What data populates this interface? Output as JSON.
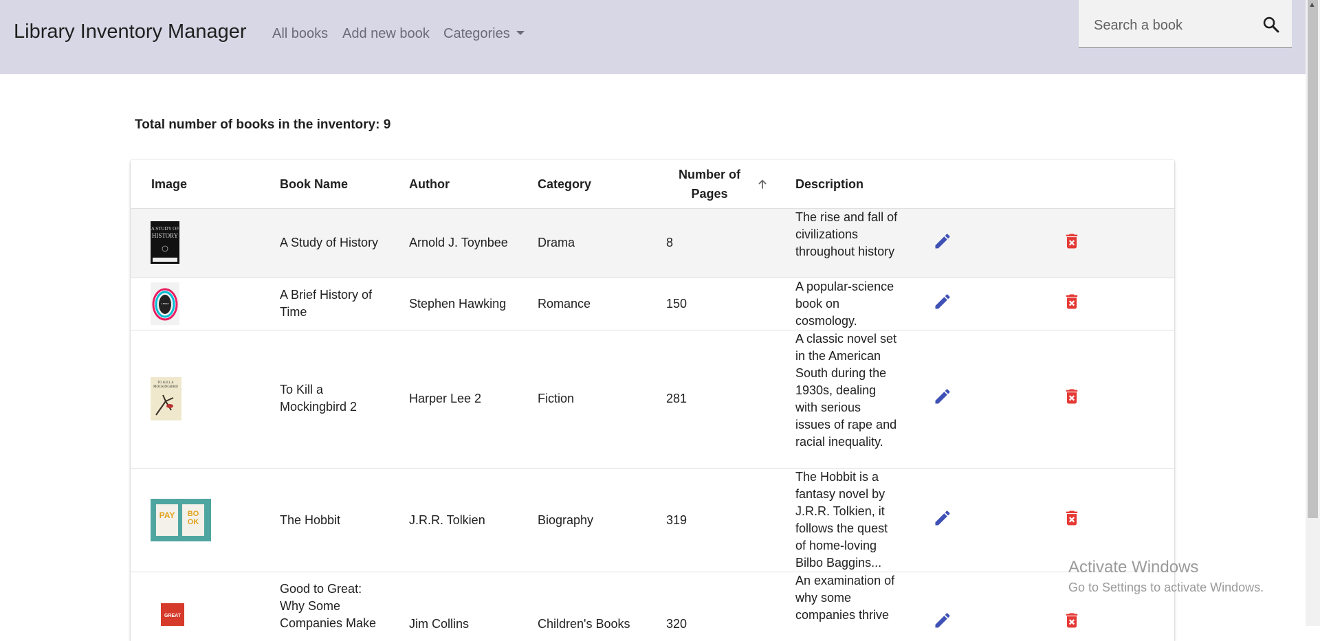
{
  "app": {
    "title": "Library Inventory Manager",
    "nav": {
      "all_books": "All books",
      "add_new_book": "Add new book",
      "categories": "Categories"
    },
    "search": {
      "placeholder": "Search a book",
      "value": "",
      "icon": "search-icon"
    }
  },
  "summary": {
    "total_label": "Total number of books in the inventory: 9"
  },
  "table": {
    "headers": {
      "image": "Image",
      "book_name": "Book Name",
      "author": "Author",
      "category": "Category",
      "pages": "Number of Pages",
      "description": "Description"
    },
    "sort": {
      "column": "pages",
      "direction": "ascending",
      "icon": "arrow-up-icon"
    },
    "rows": [
      {
        "name": "A Study of History",
        "author": "Arnold J. Toynbee",
        "category": "Drama",
        "pages": "8",
        "description": "The rise and fall of civilizations throughout history",
        "cover_text": "A STUDY OF HISTORY",
        "cover_subtext": "ARNOLD J. TOYNBEE"
      },
      {
        "name": "A Brief History of Time",
        "author": "Stephen Hawking",
        "category": "Romance",
        "pages": "150",
        "description": "A popular-science book on cosmology.",
        "cover_text": "A BRIEF HISTORY OF TIME"
      },
      {
        "name": "To Kill a Mockingbird 2",
        "author": "Harper Lee 2",
        "category": "Fiction",
        "pages": "281",
        "description": "A classic novel set in the American South during the 1930s, dealing with serious issues of rape and racial inequality.",
        "cover_text": "TO KILL A MOCKINGBIRD"
      },
      {
        "name": "The Hobbit",
        "author": "J.R.R. Tolkien",
        "category": "Biography",
        "pages": "319",
        "description": "The Hobbit is a fantasy novel by J.R.R. Tolkien, it follows the quest of home-loving Bilbo Baggins...",
        "cover_text": "BOOK"
      },
      {
        "name": "Good to Great: Why Some Companies Make",
        "author": "Jim Collins",
        "category": "Children's Books",
        "pages": "320",
        "description": "An examination of why some companies thrive",
        "cover_text": "GREAT"
      }
    ],
    "row_icons": {
      "edit": "pencil-icon",
      "delete": "trash-icon"
    }
  },
  "colors": {
    "navbar": "#d7d7e6",
    "edit": "#3f51b5",
    "delete": "#e53935",
    "row_highlight": "#f4f4f4"
  },
  "watermark": {
    "line1": "Activate Windows",
    "line2": "Go to Settings to activate Windows."
  }
}
